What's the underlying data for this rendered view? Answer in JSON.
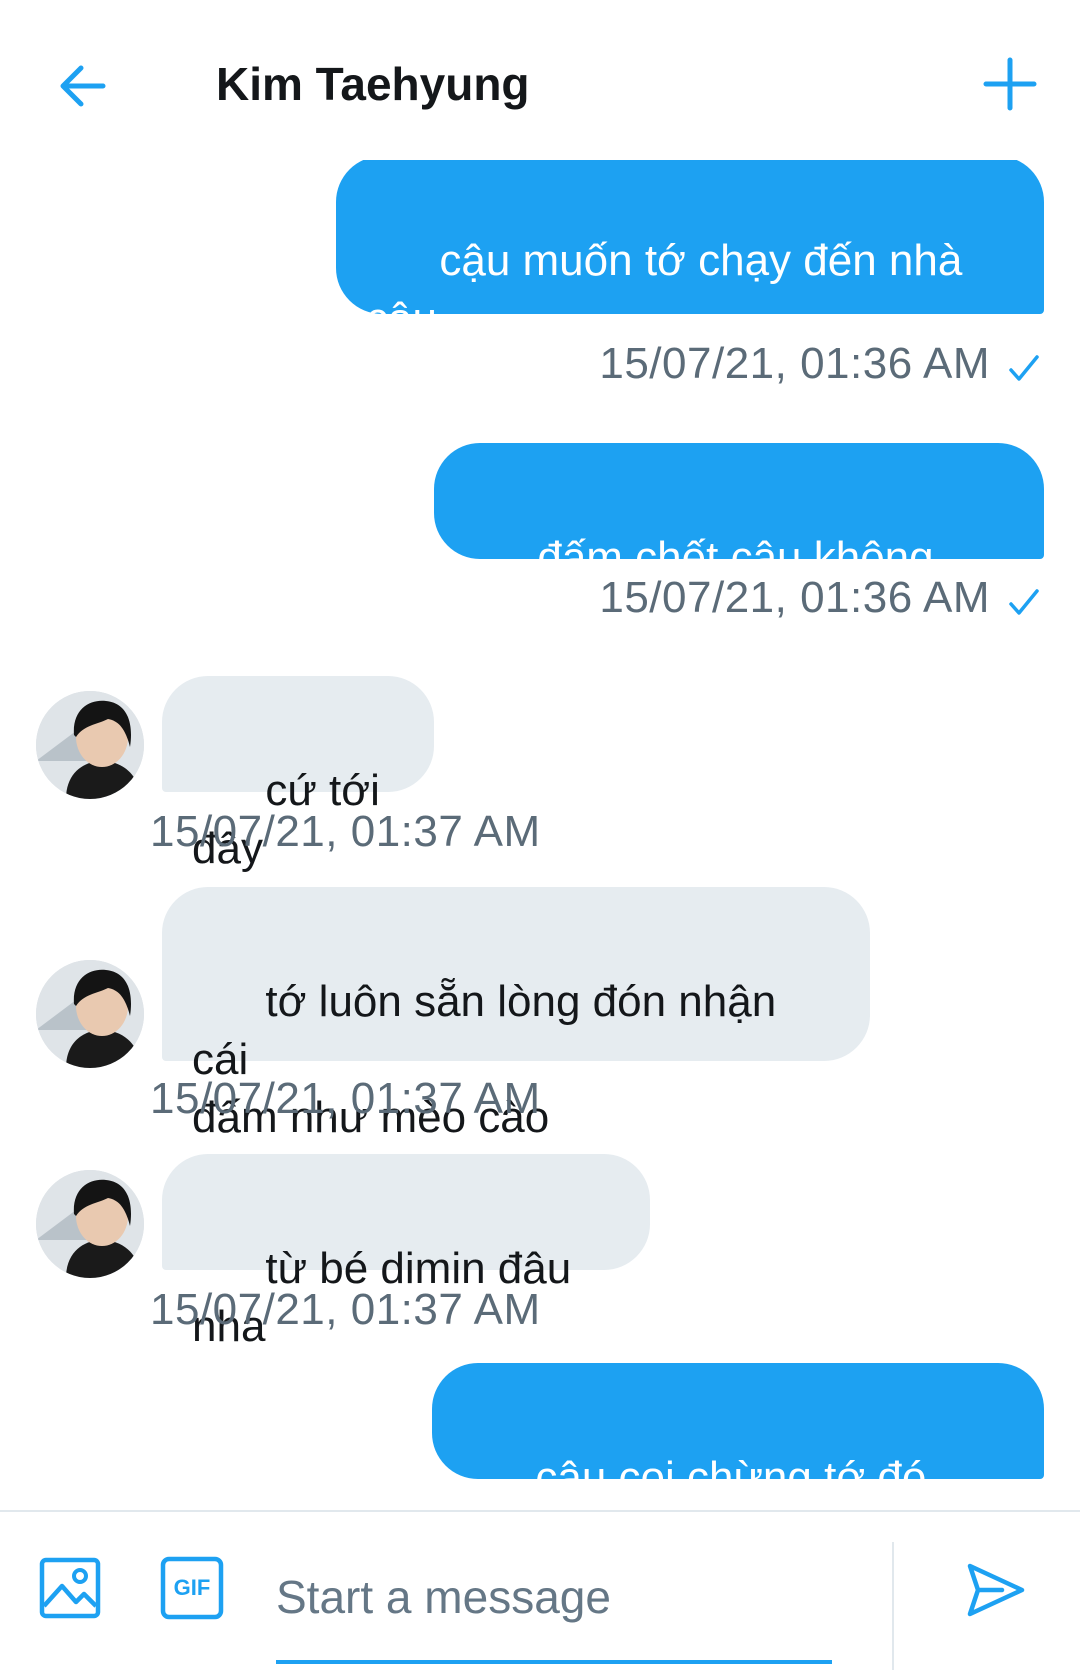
{
  "header": {
    "back_icon": "arrow-left-icon",
    "title": "Kim Taehyung",
    "add_icon": "plus-icon",
    "accent_color": "#1da1f2"
  },
  "messages": [
    {
      "direction": "sent",
      "text": "cậu muốn tớ chạy đến nhà\ncậu",
      "time": "15/07/21, 01:36 AM",
      "read_icon": "checkmark-icon"
    },
    {
      "direction": "sent",
      "text": "đấm chết cậu không hả??",
      "time": "15/07/21, 01:36 AM",
      "read_icon": "checkmark-icon"
    },
    {
      "direction": "received",
      "text": "cứ tới đây",
      "time": "15/07/21, 01:37 AM"
    },
    {
      "direction": "received",
      "text": "tớ luôn sẵn lòng đón nhận cái\nđấm như mèo cào",
      "time": "15/07/21, 01:37 AM"
    },
    {
      "direction": "received",
      "text": "từ bé dimin đâu nha",
      "time": "15/07/21, 01:37 AM"
    },
    {
      "direction": "sent",
      "text": "cậu coi chừng tớ đó",
      "emoji": "🤬🤬",
      "emoji_icon": "face-with-symbols-on-mouth-icon"
    }
  ],
  "composer": {
    "image_icon": "image-icon",
    "gif_label": "GIF",
    "placeholder": "Start a message",
    "value": "",
    "send_icon": "send-icon"
  },
  "colors": {
    "sent_bubble": "#1da1f2",
    "received_bubble": "#e6ecf0",
    "timestamp": "#5b6b78"
  }
}
